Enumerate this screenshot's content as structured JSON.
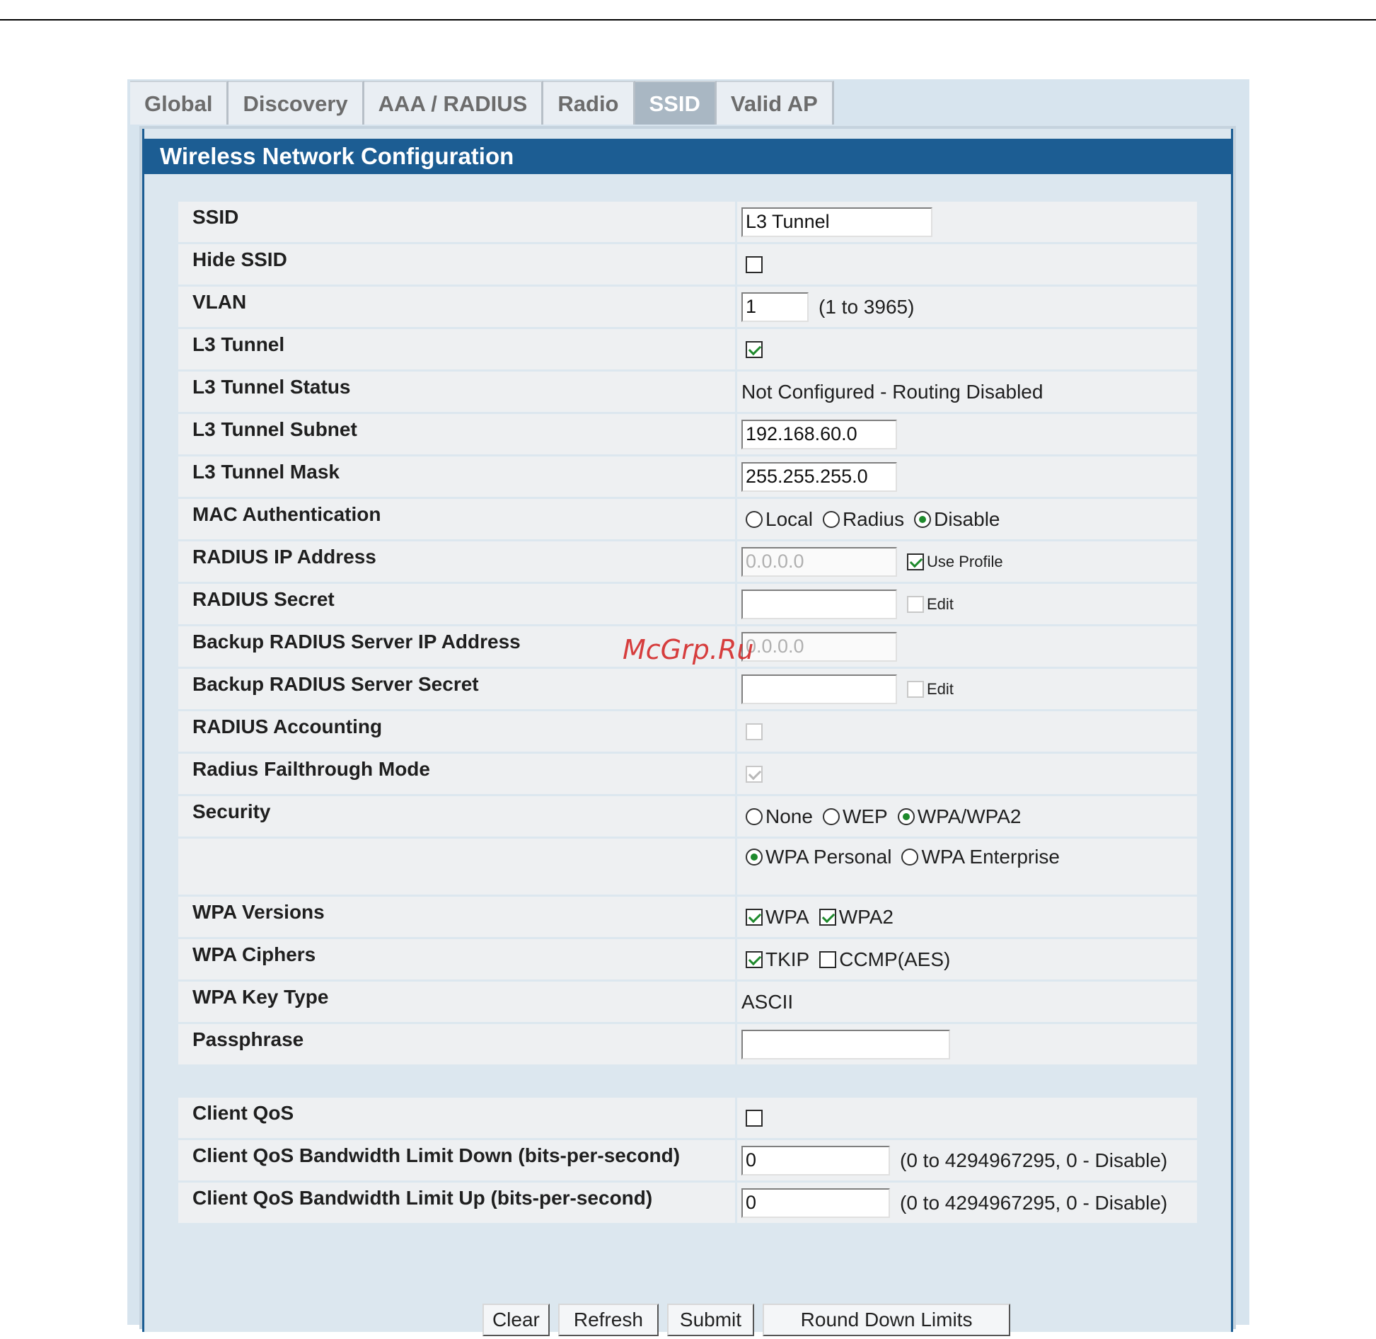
{
  "tabs": [
    {
      "label": "Global",
      "active": false
    },
    {
      "label": "Discovery",
      "active": false
    },
    {
      "label": "AAA / RADIUS",
      "active": false
    },
    {
      "label": "Radio",
      "active": false
    },
    {
      "label": "SSID",
      "active": true
    },
    {
      "label": "Valid AP",
      "active": false
    }
  ],
  "panel": {
    "title": "Wireless Network Configuration"
  },
  "fields": {
    "ssid": {
      "label": "SSID",
      "value": "L3 Tunnel"
    },
    "hide_ssid": {
      "label": "Hide SSID",
      "checked": false
    },
    "vlan": {
      "label": "VLAN",
      "value": "1",
      "hint": "(1 to 3965)"
    },
    "l3_tunnel": {
      "label": "L3 Tunnel",
      "checked": true
    },
    "l3_tunnel_status": {
      "label": "L3 Tunnel Status",
      "value": "Not Configured - Routing Disabled"
    },
    "l3_tunnel_subnet": {
      "label": "L3 Tunnel Subnet",
      "value": "192.168.60.0"
    },
    "l3_tunnel_mask": {
      "label": "L3 Tunnel Mask",
      "value": "255.255.255.0"
    },
    "mac_auth": {
      "label": "MAC Authentication",
      "options": [
        "Local",
        "Radius",
        "Disable"
      ],
      "selected": "Disable"
    },
    "radius_ip": {
      "label": "RADIUS IP Address",
      "value": "0.0.0.0",
      "use_profile_label": "Use Profile",
      "use_profile": true
    },
    "radius_secret": {
      "label": "RADIUS Secret",
      "value": "",
      "edit_label": "Edit",
      "edit": false
    },
    "backup_radius_ip": {
      "label": "Backup RADIUS Server IP Address",
      "value": "0.0.0.0"
    },
    "backup_radius_secret": {
      "label": "Backup RADIUS Server Secret",
      "value": "",
      "edit_label": "Edit",
      "edit": false
    },
    "radius_accounting": {
      "label": "RADIUS Accounting",
      "checked": false
    },
    "radius_fallthrough": {
      "label": "Radius Failthrough Mode",
      "checked": true
    },
    "security": {
      "label": "Security",
      "options": [
        "None",
        "WEP",
        "WPA/WPA2"
      ],
      "selected": "WPA/WPA2"
    },
    "wpa_mode": {
      "options": [
        "WPA Personal",
        "WPA Enterprise"
      ],
      "selected": "WPA Personal"
    },
    "wpa_versions": {
      "label": "WPA Versions",
      "wpa_label": "WPA",
      "wpa": true,
      "wpa2_label": "WPA2",
      "wpa2": true
    },
    "wpa_ciphers": {
      "label": "WPA Ciphers",
      "tkip_label": "TKIP",
      "tkip": true,
      "ccmp_label": "CCMP(AES)",
      "ccmp": false
    },
    "wpa_key_type": {
      "label": "WPA Key Type",
      "value": "ASCII"
    },
    "passphrase": {
      "label": "Passphrase",
      "value": ""
    },
    "client_qos": {
      "label": "Client QoS",
      "checked": false
    },
    "qos_down": {
      "label": "Client QoS Bandwidth Limit Down (bits-per-second)",
      "value": "0",
      "hint": "(0 to 4294967295, 0 - Disable)"
    },
    "qos_up": {
      "label": "Client QoS Bandwidth Limit Up (bits-per-second)",
      "value": "0",
      "hint": "(0 to 4294967295, 0 - Disable)"
    }
  },
  "buttons": {
    "clear": "Clear",
    "refresh": "Refresh",
    "submit": "Submit",
    "round_down": "Round Down Limits"
  },
  "watermark": "McGrp.Ru",
  "colors": {
    "header": "#1c5d93",
    "active_tab": "#a9b7c3",
    "check": "#1e8a2c"
  }
}
